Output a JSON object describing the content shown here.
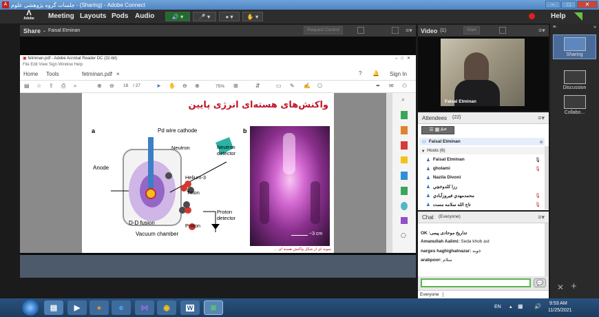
{
  "window": {
    "title": "جلسات گروه پژوهشي علوم - (Sharing) - Adobe Connect"
  },
  "menubar": {
    "logo": "Adobe",
    "items": [
      "Meeting",
      "Layouts",
      "Pods",
      "Audio"
    ],
    "help": "Help"
  },
  "share_pod": {
    "title": "Share",
    "presenter": "Faisal Etminan",
    "request_control": "Request Control"
  },
  "acrobat": {
    "title": "fetminan.pdf - Adobe Acrobat Reader DC (32-bit)",
    "menu": "File  Edit  View  Sign  Window  Help",
    "tabs": {
      "home": "Home",
      "tools": "Tools",
      "file": "fetminan.pdf",
      "sign_in": "Sign In"
    },
    "page_num": "18",
    "page_total": "/ 27",
    "zoom": "75%"
  },
  "slide": {
    "title": "واكنش‌های هسته‌ای انرژی پایین",
    "label_a": "a",
    "label_b": "b",
    "pd_wire": "Pd wire cathode",
    "anode": "Anode",
    "neutron": "Neutron",
    "neutron_detector": "Neutron detector",
    "helium": "Helium-3",
    "triton": "Triton",
    "proton_detector": "Proton detector",
    "dd_fusion": "D-D fusion",
    "proton": "Proton",
    "vacuum": "Vacuum chamber",
    "scale": "~3 cm",
    "caption": "نمونه ای از شکل واکنش هسته ای ..."
  },
  "video_pod": {
    "title": "Video",
    "count": "(1)",
    "start": "Start",
    "caption": "Faisal Etminan"
  },
  "attendees": {
    "title": "Attendees",
    "count": "(22)",
    "current_user": "Faisal Etminan",
    "hosts_label": "Hosts (6)",
    "rows": [
      "Faisal Etminan",
      "gholami",
      "Nazila Divoni",
      "رزا كلدوخچي",
      "محمدمهدي فيروزآبادي",
      "تاج الله سلامه مست"
    ]
  },
  "chat": {
    "title": "Chat",
    "scope": "(Everyone)",
    "messages": [
      {
        "name": "OK :تداریخ موحادی پیمی",
        "text": ""
      },
      {
        "name": "Amanullah Aalimi:",
        "text": "Seda khob ast"
      },
      {
        "name": "narges haghighatnazar:",
        "text": "خوبه"
      },
      {
        "name": "arabpoor:",
        "text": "سلام"
      }
    ],
    "recipient": "Everyone"
  },
  "sidebar": {
    "tabs": [
      "Sharing",
      "Discussion",
      "Collabo..."
    ]
  },
  "taskbar": {
    "lang": "EN",
    "time": "9:53 AM",
    "date": "11/25/2021"
  },
  "colors": {
    "accent": "#2f6db5",
    "titlebar": "#4f85c2",
    "slide_title": "#c0152a",
    "taskbar": "#1d3c5f"
  }
}
